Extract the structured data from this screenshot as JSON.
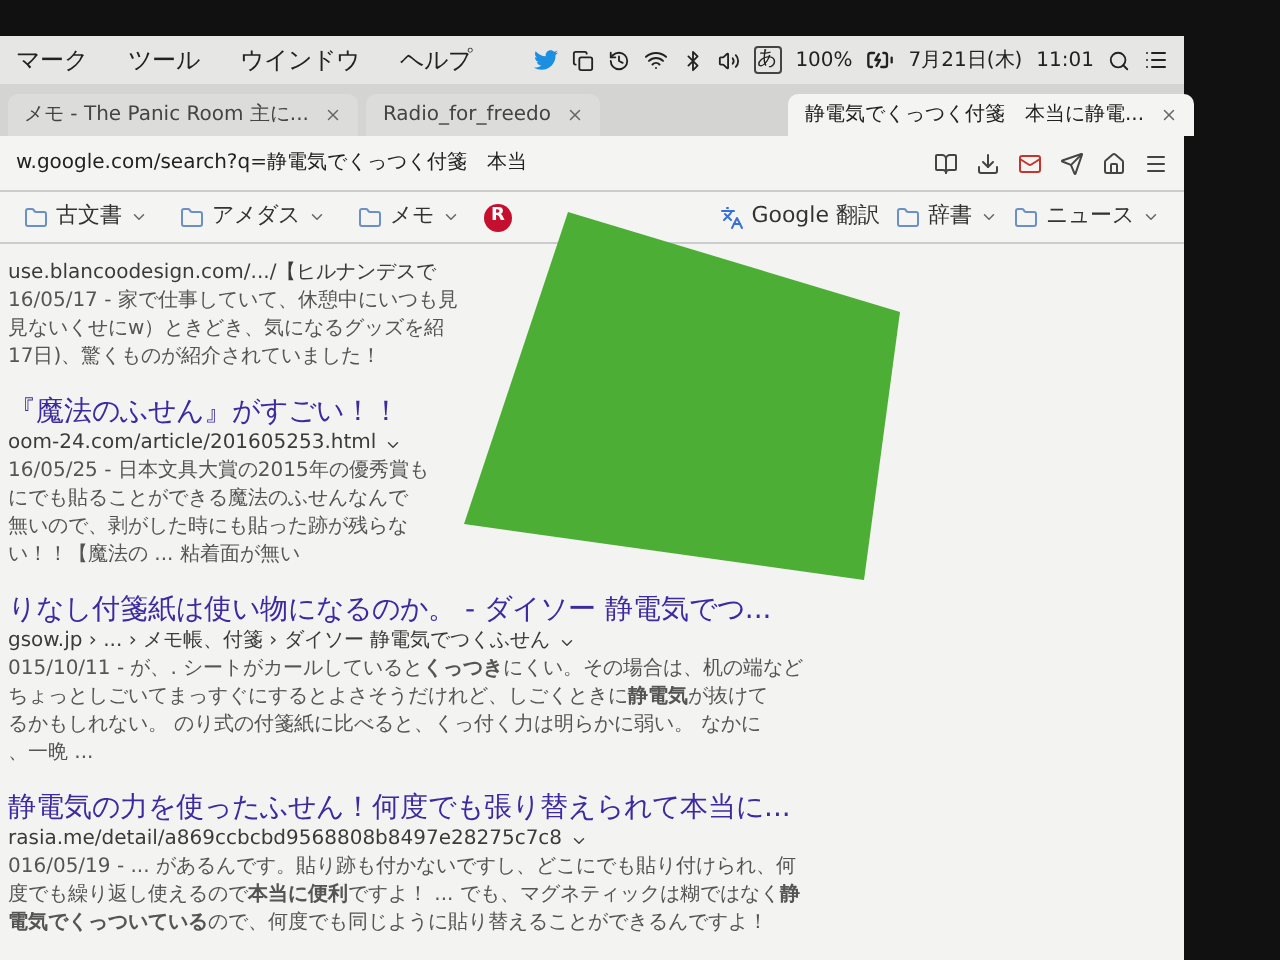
{
  "menu_bar": {
    "menus": [
      "マーク",
      "ツール",
      "ウインドウ",
      "ヘルプ"
    ],
    "input_mode": "あ",
    "battery": "100%",
    "date": "7月21日(木)",
    "time": "11:01"
  },
  "tabs": [
    {
      "label": "メモ - The Panic Room 主に...",
      "selected": false
    },
    {
      "label": "Radio_for_freedo",
      "selected": false
    },
    {
      "label": "静電気でくっつく付箋　本当に静電...",
      "selected": true
    }
  ],
  "address_bar": {
    "url": "w.google.com/search?q=静電気でくっつく付箋　本当"
  },
  "bookmarks": [
    {
      "kind": "folder",
      "label": "古文書"
    },
    {
      "kind": "folder",
      "label": "アメダス"
    },
    {
      "kind": "folder",
      "label": "メモ"
    },
    {
      "kind": "badge",
      "label": "R"
    }
  ],
  "bookmarks_right": [
    {
      "kind": "translate",
      "label": "Google 翻訳"
    },
    {
      "kind": "folder",
      "label": "辞書"
    },
    {
      "kind": "folder",
      "label": "ニュース"
    }
  ],
  "results": [
    {
      "url": "use.blancoodesign.com/.../【ヒルナンデスで",
      "snippet": [
        "16/05/17 - 家で仕事していて、休憩中にいつも見",
        "見ないくせにw）ときどき、気になるグッズを紹",
        "17日)、驚くものが紹介されていました！"
      ]
    },
    {
      "title": "『魔法のふせん』がすごい！！",
      "url": "oom-24.com/article/201605253.html",
      "snippet": [
        "16/05/25 - 日本文具大賞の2015年の優秀賞も",
        "にでも貼ることができる魔法のふせんなんで",
        "無いので、剥がした時にも貼った跡が残らな",
        "い！！【魔法の ... 粘着面が無い"
      ]
    },
    {
      "title": "りなし付箋紙は使い物になるのか。 - ダイソー 静電気でつ...",
      "url": "gsow.jp › ... › メモ帳、付箋 › ダイソー 静電気でつくふせん",
      "snippet": [
        "015/10/11 - が、. シートがカールしていると**くっつき**にくい。その場合は、机の端など",
        "ちょっとしごいてまっすぐにするとよさそうだけれど、しごくときに**静電気**が抜けて",
        "るかもしれない。 のり式の付箋紙に比べると、くっ付く力は明らかに弱い。 なかに",
        "、一晩 ..."
      ]
    },
    {
      "title": "静電気の力を使ったふせん！何度でも張り替えられて本当に...",
      "url": "rasia.me/detail/a869ccbcbd9568808b8497e28275c7c8",
      "snippet": [
        "016/05/19 - ... があるんです。貼り跡も付かないですし、どこにでも貼り付けられ、何",
        "度でも繰り返し使えるので**本当に便利**ですよ！ ... でも、マグネティックは糊ではなく**静**",
        "**電気でくっついている**ので、何度でも同じように貼り替えることができるんですよ！"
      ]
    }
  ]
}
